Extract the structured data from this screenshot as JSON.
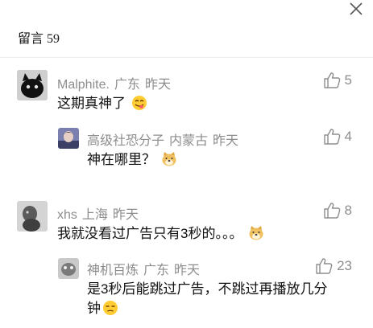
{
  "header": {
    "title": "留言",
    "count": "59"
  },
  "comments": [
    {
      "user": "Malphite.",
      "location": "广东",
      "time": "昨天",
      "likes": "5",
      "text": "这期真神了",
      "emoji": "yum-face-icon"
    },
    {
      "user": "高级社恐分子",
      "location": "内蒙古",
      "time": "昨天",
      "likes": "4",
      "text": "神在哪里？",
      "emoji": "doge-icon"
    },
    {
      "user": "xhs",
      "location": "上海",
      "time": "昨天",
      "likes": "8",
      "text": "我就没看过广告只有3秒的。。。",
      "emoji": "doge-icon"
    },
    {
      "user": "神机百炼",
      "location": "广东",
      "time": "昨天",
      "likes": "23",
      "text_line1": "是3秒后能跳过广告，不跳过再播放几分",
      "text_line2": "钟",
      "emoji": "unamused-face-icon"
    }
  ]
}
